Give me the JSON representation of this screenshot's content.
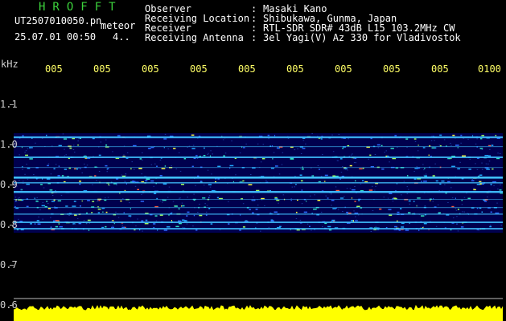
{
  "header": {
    "brand": "HROFFT",
    "filename": "UT2507010050.pn",
    "mode": "meteor",
    "datetime": "25.07.01 00:50",
    "count": "4.."
  },
  "meta": [
    {
      "key": "Observer",
      "sep": ":",
      "value": "Masaki Kano"
    },
    {
      "key": "Receiving Location",
      "sep": ":",
      "value": "Shibukawa, Gunma, Japan"
    },
    {
      "key": "Receiver",
      "sep": ":",
      "value": "RTL-SDR SDR# 43dB L15 103.2MHz CW"
    },
    {
      "key": "Receiving Antenna",
      "sep": ":",
      "value": "3el Yagi(V) Az 330 for Vladivostok"
    }
  ],
  "axis": {
    "y_unit": "kHz",
    "y_ticks": [
      "1.1",
      "1.0",
      "0.9",
      "0.8",
      "0.7",
      "0.6"
    ],
    "x_ticks": [
      "005",
      "005",
      "005",
      "005",
      "005",
      "005",
      "005",
      "005",
      "005",
      "0100"
    ]
  },
  "colors": {
    "background": "#000000",
    "waterfall_bg": "#000050",
    "signal_line": "#40c0ff",
    "level_trace": "#ffff00",
    "brand": "#3cd23c",
    "tick_top": "#ffff66"
  }
}
